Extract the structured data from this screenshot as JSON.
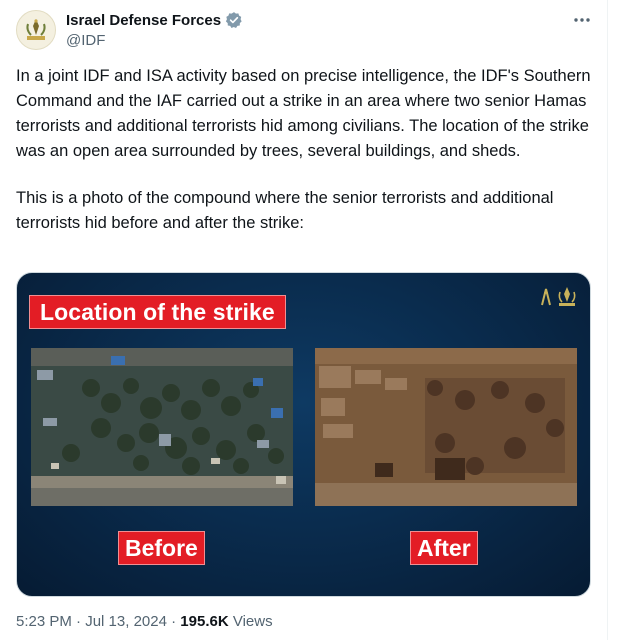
{
  "author": {
    "name": "Israel Defense Forces",
    "handle": "@IDF",
    "verified": true,
    "verified_badge_color": "#829aab"
  },
  "more_icon": "more-horizontal-icon",
  "tweet": {
    "paragraph_1": "In a joint IDF and ISA activity based on precise intelligence, the IDF's Southern Command and the IAF carried out a strike in an area where two senior Hamas terrorists and additional terrorists hid among civilians. The location of the strike was an open area surrounded by trees, several buildings, and sheds.",
    "paragraph_2": "This is a photo of the compound where the senior terrorists and additional terrorists hid before and after the strike:"
  },
  "media": {
    "title": "Location of the strike",
    "before_label": "Before",
    "after_label": "After",
    "accent_color": "#e31d25",
    "background_color": "#0a2c4e"
  },
  "meta": {
    "time": "5:23 PM",
    "separator": "·",
    "date": "Jul 13, 2024",
    "views_count": "195.6K",
    "views_label": "Views"
  }
}
